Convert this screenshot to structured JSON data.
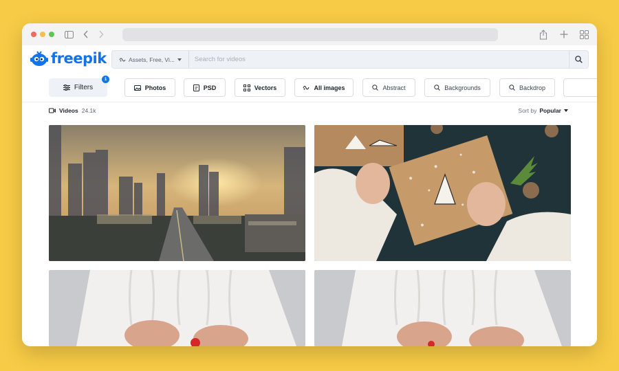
{
  "browser": {
    "icons": [
      "sidebar-icon",
      "back-icon",
      "forward-icon",
      "share-icon",
      "new-tab-icon",
      "tabs-overview-icon"
    ]
  },
  "header": {
    "logo_text": "freepik",
    "search": {
      "scope_label": "Assets, Free, Vi...",
      "placeholder": "Search for videos"
    }
  },
  "filters": {
    "filters_label": "Filters",
    "filters_count": "1",
    "chips": [
      {
        "label": "Photos",
        "icon": "photo-icon"
      },
      {
        "label": "PSD",
        "icon": "psd-icon"
      },
      {
        "label": "Vectors",
        "icon": "vector-icon"
      },
      {
        "label": "All images",
        "icon": "images-icon"
      },
      {
        "label": "Abstract",
        "icon": "search-icon"
      },
      {
        "label": "Backgrounds",
        "icon": "search-icon"
      },
      {
        "label": "Backdrop",
        "icon": "search-icon"
      }
    ]
  },
  "results": {
    "type_label": "Videos",
    "count": "24.1k",
    "sort_label": "Sort by",
    "sort_value": "Popular"
  },
  "videos": [
    {
      "subject": "city skyline at sunset with highway"
    },
    {
      "subject": "hands wrapping christmas gift"
    },
    {
      "subject": "person in white sweater with red ribbon"
    },
    {
      "subject": "person in white sweater with red ribbon"
    }
  ],
  "colors": {
    "background": "#f7cb46",
    "brand": "#1273eb"
  }
}
